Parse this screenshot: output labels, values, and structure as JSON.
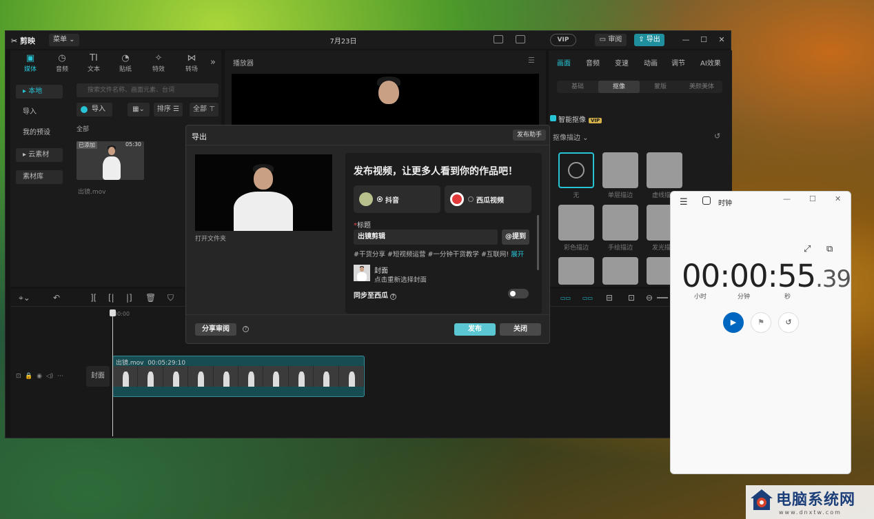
{
  "editor": {
    "app_name": "剪映",
    "menu_label": "菜单",
    "title": "7月23日",
    "vip_label": "VIP",
    "feedback_label": "审阅",
    "export_label": "导出",
    "tool_tabs": [
      {
        "label": "媒体",
        "icon": "media-icon"
      },
      {
        "label": "音频",
        "icon": "audio-icon"
      },
      {
        "label": "文本",
        "icon": "text-icon"
      },
      {
        "label": "贴纸",
        "icon": "sticker-icon"
      },
      {
        "label": "特效",
        "icon": "effect-icon"
      },
      {
        "label": "转场",
        "icon": "transition-icon"
      }
    ],
    "side_nav": [
      "本地",
      "导入",
      "我的预设",
      "云素材",
      "素材库"
    ],
    "search_placeholder": "搜索文件名称、画面元素、台词",
    "import_label": "导入",
    "sort_label": "排序",
    "filter_label": "全部",
    "all_label": "全部",
    "thumb_badge": "已添加",
    "thumb_duration": "05:30",
    "thumb_name": "出镜.mov",
    "player_title": "播放器",
    "prop_tabs": [
      "画面",
      "音频",
      "变速",
      "动画",
      "调节",
      "AI效果"
    ],
    "seg_tabs": [
      "基础",
      "抠像",
      "蒙版",
      "美颜美体"
    ],
    "smart_cutout": "智能抠像",
    "vip_tag": "VIP",
    "outline_label": "抠像描边",
    "cutout_caps": [
      "无",
      "单层描边",
      "虚线描边",
      "彩色描边",
      "手绘描边",
      "发光描边"
    ],
    "ruler_time": "00:00",
    "cover_label": "封面",
    "clip_name": "出镜.mov",
    "clip_duration": "00:05:29:10"
  },
  "dialog": {
    "title": "导出",
    "helper": "发布助手",
    "open_folder": "打开文件夹",
    "publish_heading": "发布视频，让更多人看到你的作品吧！",
    "platforms": [
      {
        "name": "抖音",
        "selected": true
      },
      {
        "name": "西瓜视频",
        "selected": false
      }
    ],
    "title_label": "标题",
    "title_value": "出镜剪辑",
    "mention_label": "@提到",
    "hashtags": "#干货分享 #短视频运营 #一分钟干货教学 #互联网!",
    "expand_label": "展开",
    "cover_title": "封面",
    "cover_sub": "点击重新选择封面",
    "sync_label": "同步至西瓜",
    "share_label": "分享审阅",
    "publish_label": "发布",
    "close_label": "关闭"
  },
  "clock": {
    "title": "时钟",
    "time_main": "00:00:55",
    "time_frac": ".39",
    "unit_hours": "小时",
    "unit_minutes": "分钟",
    "unit_seconds": "秒"
  },
  "watermark": {
    "text": "电脑系统网",
    "url": "www.dnxtw.com"
  },
  "colors": {
    "accent": "#27c4d6",
    "publish": "#5ac7d3",
    "clock_play": "#0067c0"
  }
}
